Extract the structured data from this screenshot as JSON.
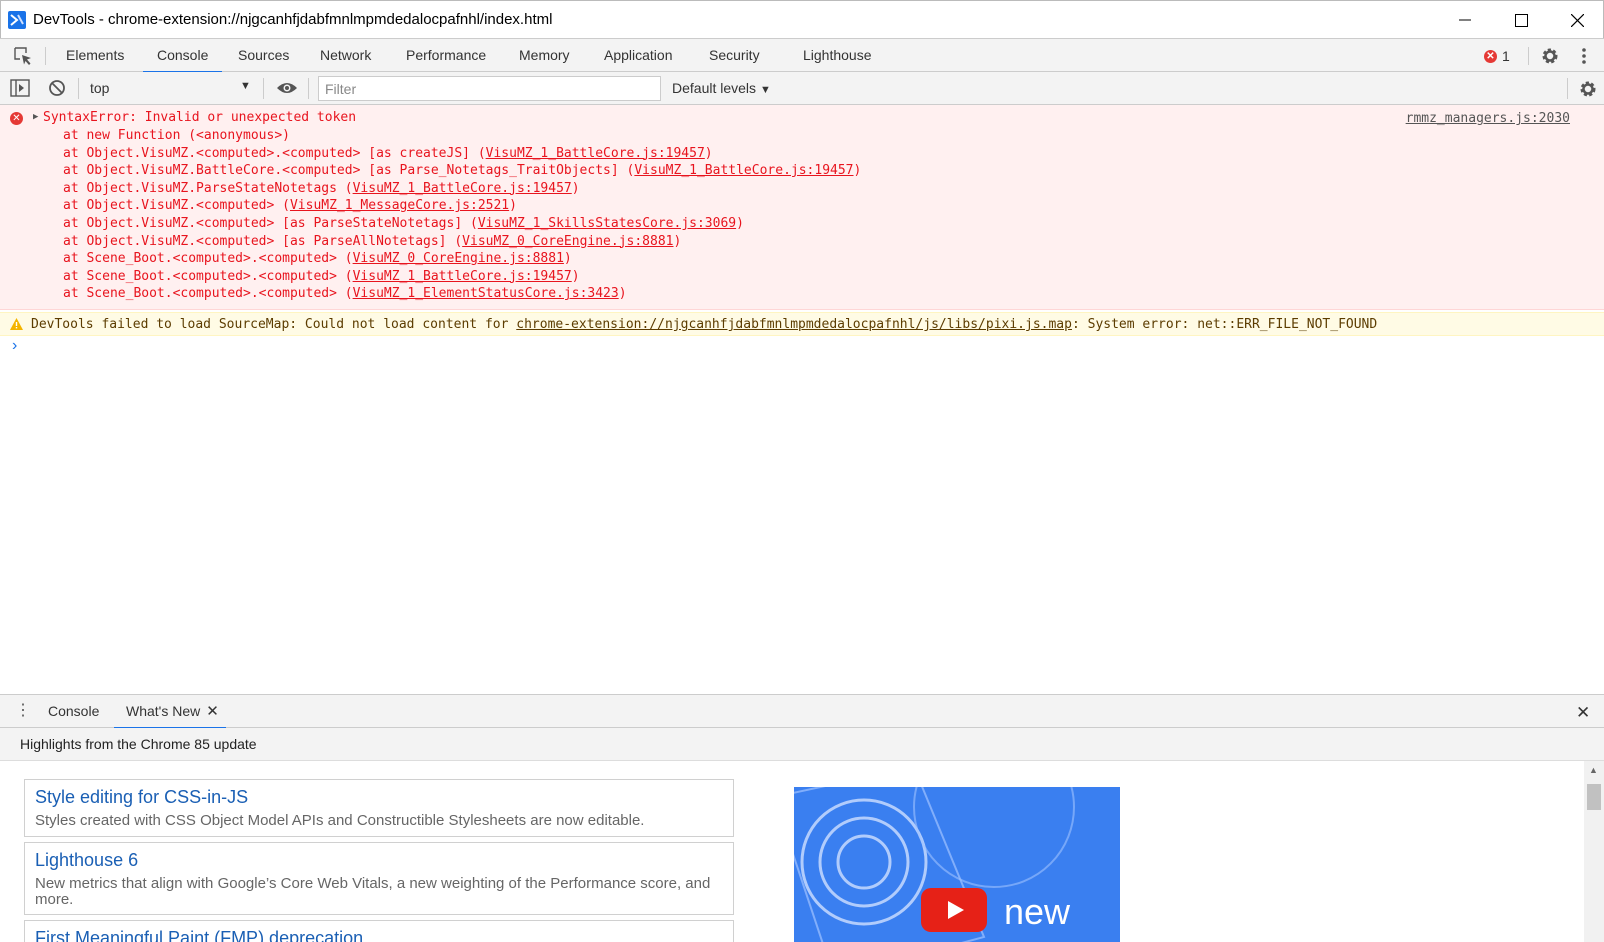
{
  "window": {
    "title": "DevTools - chrome-extension://njgcanhfjdabfmnlmpmdedalocpafnhl/index.html"
  },
  "main_tabs": [
    "Elements",
    "Console",
    "Sources",
    "Network",
    "Performance",
    "Memory",
    "Application",
    "Security",
    "Lighthouse"
  ],
  "active_tab": "Console",
  "error_count": "1",
  "console_toolbar": {
    "context": "top",
    "filter_placeholder": "Filter",
    "levels": "Default levels"
  },
  "error": {
    "message": "SyntaxError: Invalid or unexpected token",
    "source": "rmmz_managers.js:2030",
    "stack": [
      {
        "text": "at new Function (<anonymous>)",
        "link": ""
      },
      {
        "text": "at Object.VisuMZ.<computed>.<computed> [as createJS] (",
        "link": "VisuMZ_1_BattleCore.js:19457"
      },
      {
        "text": "at Object.VisuMZ.BattleCore.<computed> [as Parse_Notetags_TraitObjects] (",
        "link": "VisuMZ_1_BattleCore.js:19457"
      },
      {
        "text": "at Object.VisuMZ.ParseStateNotetags (",
        "link": "VisuMZ_1_BattleCore.js:19457"
      },
      {
        "text": "at Object.VisuMZ.<computed> (",
        "link": "VisuMZ_1_MessageCore.js:2521"
      },
      {
        "text": "at Object.VisuMZ.<computed> [as ParseStateNotetags] (",
        "link": "VisuMZ_1_SkillsStatesCore.js:3069"
      },
      {
        "text": "at Object.VisuMZ.<computed> [as ParseAllNotetags] (",
        "link": "VisuMZ_0_CoreEngine.js:8881"
      },
      {
        "text": "at Scene_Boot.<computed>.<computed> (",
        "link": "VisuMZ_0_CoreEngine.js:8881"
      },
      {
        "text": "at Scene_Boot.<computed>.<computed> (",
        "link": "VisuMZ_1_BattleCore.js:19457"
      },
      {
        "text": "at Scene_Boot.<computed>.<computed> (",
        "link": "VisuMZ_1_ElementStatusCore.js:3423"
      }
    ]
  },
  "warning": {
    "prefix": "DevTools failed to load SourceMap: Could not load content for ",
    "link": "chrome-extension://njgcanhfjdabfmnlmpmdedalocpafnhl/js/libs/pixi.js.map",
    "suffix": ": System error: net::ERR_FILE_NOT_FOUND"
  },
  "drawer": {
    "tabs": [
      "Console",
      "What's New"
    ],
    "active_tab": "What's New",
    "highlights": "Highlights from the Chrome 85 update",
    "cards": [
      {
        "title": "Style editing for CSS-in-JS",
        "desc": "Styles created with CSS Object Model APIs and Constructible Stylesheets are now editable."
      },
      {
        "title": "Lighthouse 6",
        "desc": "New metrics that align with Google’s Core Web Vitals, a new weighting of the Performance score, and more."
      },
      {
        "title": "First Meaningful Paint (FMP) deprecation",
        "desc": ""
      }
    ],
    "video_text": "new"
  },
  "colors": {
    "accent": "#1a73e8",
    "error_text": "#e8141e",
    "error_bg": "#fff0f0",
    "warning_bg": "#fffbe5"
  }
}
